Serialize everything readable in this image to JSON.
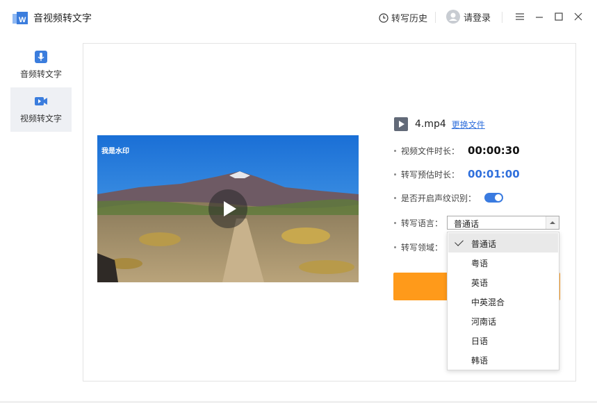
{
  "app": {
    "title": "音视频转文字",
    "logo_icon": "app-logo-icon"
  },
  "header": {
    "history_label": "转写历史",
    "history_icon": "clock-icon",
    "login_label": "请登录",
    "avatar_icon": "user-avatar-icon",
    "window_controls": [
      "menu-icon",
      "minimize-icon",
      "maximize-icon",
      "close-icon"
    ]
  },
  "sidebar": {
    "items": [
      {
        "label": "音频转文字",
        "icon": "microphone-icon",
        "active": false
      },
      {
        "label": "视频转文字",
        "icon": "video-camera-icon",
        "active": true
      }
    ]
  },
  "video": {
    "watermark": "我是水印",
    "play_icon": "play-icon"
  },
  "file": {
    "name": "4.mp4",
    "change_label": "更换文件",
    "icon": "video-file-icon"
  },
  "info": {
    "duration_label": "视频文件时长：",
    "duration_value": "00:00:30",
    "estimate_label": "转写预估时长：",
    "estimate_value": "00:01:00",
    "voiceprint_label": "是否开启声纹识别：",
    "voiceprint_on": true,
    "language_label": "转写语言：",
    "domain_label": "转写领域："
  },
  "language_select": {
    "selected": "普通话",
    "options": [
      "普通话",
      "粤语",
      "英语",
      "中英混合",
      "河南话",
      "日语",
      "韩语"
    ]
  },
  "colors": {
    "accent": "#2f6fdc",
    "start_button": "#ff9a1a",
    "toggle_on": "#3a7be0"
  }
}
